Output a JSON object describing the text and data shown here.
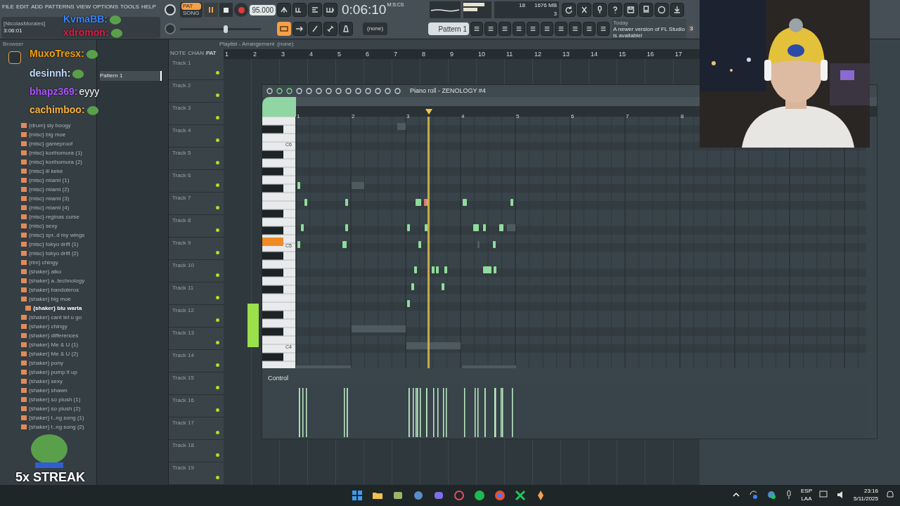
{
  "menu": [
    "FILE",
    "EDIT",
    "ADD",
    "PATTERNS",
    "VIEW",
    "OPTIONS",
    "TOOLS",
    "HELP"
  ],
  "hint": {
    "user": "[NicolasMorales]",
    "time": "3:06:01"
  },
  "transport": {
    "modes": [
      {
        "label": "PAT",
        "selected": true
      },
      {
        "label": "SONG",
        "selected": false
      }
    ],
    "playing": true,
    "recording": true,
    "master_pitch": {
      "level": 0.57
    },
    "tempo": "95.000",
    "time": "0:06:10",
    "time_unit": "M:S:CS"
  },
  "monitor": {
    "voices": "18",
    "memory": "1676 MB",
    "polyphony": "3"
  },
  "pattern": {
    "arrangement": "(none)",
    "name": "Pattern 1"
  },
  "news": {
    "when": "Today",
    "text": "A newer version of FL Studio is available!",
    "count": "3"
  },
  "browser": {
    "title": "Browser",
    "items": [
      {
        "label": "{drum} sly boogy",
        "selected": false
      },
      {
        "label": "{misc} big moe",
        "selected": false
      },
      {
        "label": "{misc} gameproof",
        "selected": false
      },
      {
        "label": "{misc} korihomura (1)",
        "selected": false
      },
      {
        "label": "{misc} korihomura (2)",
        "selected": false
      },
      {
        "label": "{misc} lil keke",
        "selected": false
      },
      {
        "label": "{misc} miami (1)",
        "selected": false
      },
      {
        "label": "{misc} miami (2)",
        "selected": false
      },
      {
        "label": "{misc} miami (3)",
        "selected": false
      },
      {
        "label": "{misc} miami (4)",
        "selected": false
      },
      {
        "label": "{misc} reginas curse",
        "selected": false
      },
      {
        "label": "{misc} sexy",
        "selected": false
      },
      {
        "label": "{misc} spr..d my wings",
        "selected": false
      },
      {
        "label": "{misc} tokyo drift (1)",
        "selected": false
      },
      {
        "label": "{misc} tokyo drift (2)",
        "selected": false
      },
      {
        "label": "{rim} chingy",
        "selected": false
      },
      {
        "label": "{shaker} aiko",
        "selected": false
      },
      {
        "label": "{shaker} a..technology",
        "selected": false
      },
      {
        "label": "{shaker} bandoleros",
        "selected": false
      },
      {
        "label": "{shaker} big moe",
        "selected": false
      },
      {
        "label": "{shaker} blu warta",
        "selected": true
      },
      {
        "label": "{shaker} cant let u go",
        "selected": false
      },
      {
        "label": "{shaker} chingy",
        "selected": false
      },
      {
        "label": "{shaker} differences",
        "selected": false
      },
      {
        "label": "{shaker} Me & U (1)",
        "selected": false
      },
      {
        "label": "{shaker} Me & U (2)",
        "selected": false
      },
      {
        "label": "{shaker} pony",
        "selected": false
      },
      {
        "label": "{shaker} pump it up",
        "selected": false
      },
      {
        "label": "{shaker} sexy",
        "selected": false
      },
      {
        "label": "{shaker} shawn",
        "selected": false
      },
      {
        "label": "{shaker} so plush (1)",
        "selected": false
      },
      {
        "label": "{shaker} so plush (2)",
        "selected": false
      },
      {
        "label": "{shaker} t..ng song (1)",
        "selected": false
      },
      {
        "label": "{shaker} t..ng song (2)",
        "selected": false
      }
    ]
  },
  "patterns": [
    {
      "label": "Pattern 1",
      "selected": true
    }
  ],
  "playlist": {
    "title": "Playlist - Arrangement",
    "crumb": "(none)",
    "tabs": [
      "NOTE",
      "CHAN",
      "PAT"
    ],
    "ruler": [
      "1",
      "2",
      "3",
      "4",
      "5",
      "6",
      "7",
      "8",
      "9",
      "10",
      "11",
      "12",
      "13",
      "14",
      "15",
      "16",
      "17"
    ],
    "tracks": [
      "Track 1",
      "Track 2",
      "Track 3",
      "Track 4",
      "Track 5",
      "Track 6",
      "Track 7",
      "Track 8",
      "Track 9",
      "Track 10",
      "Track 11",
      "Track 12",
      "Track 13",
      "Track 14",
      "Track 15",
      "Track 16",
      "Track 17",
      "Track 18",
      "Track 19"
    ]
  },
  "piano_roll": {
    "title": "Piano roll - ZENOLOGY #4",
    "ruler": [
      "1",
      "2",
      "3",
      "4",
      "5",
      "6",
      "7",
      "8"
    ],
    "keys": [
      "C6",
      "C5",
      "C4"
    ],
    "control": "Control"
  },
  "chat": [
    {
      "user": "KvmaBB:",
      "color": "#3b82f6"
    },
    {
      "user": "xdromon:",
      "color": "#e11d48"
    },
    {
      "user": "MuxoTresx:",
      "color": "#f59e0b"
    },
    {
      "user": "desinnh:",
      "color": "#bfdbfe"
    },
    {
      "user": "bhapz369:",
      "color": "#a855f7",
      "message": "eyyy"
    },
    {
      "user": "cachimboo:",
      "color": "#f5b041"
    }
  ],
  "streak": "5x STREAK",
  "taskbar": {
    "lang": "ESP",
    "region": "LAA",
    "time": "23:16",
    "date": "5/11/2025"
  }
}
